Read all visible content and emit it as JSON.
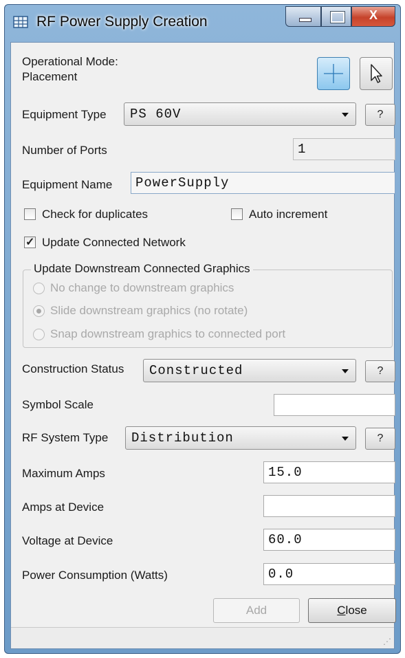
{
  "window": {
    "title": "RF Power Supply Creation",
    "close_glyph": "X",
    "icon": "app-grid-icon"
  },
  "mode": {
    "label_line1": "Operational Mode:",
    "label_line2": "Placement",
    "placement_button_icon": "crosshair-icon",
    "placement_active": true,
    "select_button_icon": "pointer-arrow-icon"
  },
  "equipment_type": {
    "label": "Equipment Type",
    "value": "PS 60V",
    "help": "?"
  },
  "ports": {
    "label": "Number of Ports",
    "value": "1"
  },
  "equipment_name": {
    "label": "Equipment Name",
    "value": "PowerSupply"
  },
  "options": {
    "check_duplicates": {
      "label": "Check for duplicates",
      "checked": false
    },
    "auto_increment": {
      "label": "Auto increment",
      "checked": false
    },
    "update_network": {
      "label": "Update Connected Network",
      "checked": true
    }
  },
  "downstream": {
    "title": "Update Downstream Connected Graphics",
    "options": [
      {
        "label": "No change to downstream graphics",
        "selected": false
      },
      {
        "label": "Slide downstream graphics (no rotate)",
        "selected": true
      },
      {
        "label": "Snap downstream graphics to connected port",
        "selected": false
      }
    ],
    "enabled": false
  },
  "construction_status": {
    "label": "Construction Status",
    "value": "Constructed",
    "help": "?"
  },
  "symbol_scale": {
    "label": "Symbol Scale",
    "value": ""
  },
  "rf_system_type": {
    "label": "RF System Type",
    "value": "Distribution",
    "help": "?"
  },
  "maximum_amps": {
    "label": "Maximum Amps",
    "value": "15.0"
  },
  "amps_at_device": {
    "label": "Amps at Device",
    "value": ""
  },
  "voltage_at_device": {
    "label": "Voltage at Device",
    "value": "60.0"
  },
  "power_consumption": {
    "label": "Power Consumption (Watts)",
    "value": "0.0"
  },
  "buttons": {
    "add": "Add",
    "close_prefix": "C",
    "close_rest": "lose",
    "add_enabled": false
  },
  "colors": {
    "title_bar": "#7aa5cf",
    "close_button": "#c6432b",
    "active_mode": "#8cc7ee",
    "dialog_bg": "#f0f0f0"
  }
}
